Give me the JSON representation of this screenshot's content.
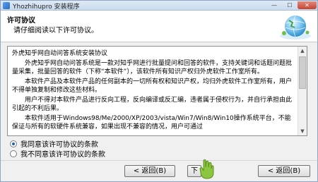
{
  "window": {
    "title": "Yhozhihupro 安装程序",
    "min_glyph": "—",
    "max_glyph": "☐",
    "close_glyph": "✕"
  },
  "header": {
    "title": "许可协议",
    "subtitle": "请仔细阅读以下许可协议。"
  },
  "license": {
    "paragraphs": [
      "外虎知乎网自动问答系统安装协议",
      "外虎知乎网自动问答系统是一款对知乎网进行批量提问和回答的软件，支持关键词和话题问题批量采集，批量回答的软件（下称“本软件”），该软件所有知识产权归外虎软件工作室所有。",
      "本软件产品及本软件产品的任何副本的一切所有权和知识产权，均归外虎软件工作室所有，用户不得单独复制和修改这些材料。",
      "用户不得对本软件产品进行反向工程，反向编译或反汇编，违者属于侵权行为，并自行承担由此引起的不利后果。",
      "本软件适用于Windows98/Me/2000/XP/2003/vista/Win7/Win8/Win10操作系统平台，不能保证与所有的软硬件系统兼容，如果出现不兼容的情况，用户可通过"
    ],
    "scroll_up_glyph": "▲",
    "scroll_down_glyph": "▼"
  },
  "options": {
    "accept_label": "我同意该许可协议的条款",
    "decline_label": "我不同意该许可协议的条款",
    "selected": "accept"
  },
  "buttons": {
    "back_label": "< 返回(B)",
    "next_label": "下",
    "cancel_label": "< 返回(B)"
  },
  "colors": {
    "accent": "#1e5fb8",
    "title_gradient_top": "#dfe9f5",
    "close_red": "#c4432f",
    "overlay_green": "#8cc63f"
  },
  "icons": {
    "app": "app-icon",
    "header_graphic": "globe-icon",
    "overlay": "green-hand-icon"
  }
}
